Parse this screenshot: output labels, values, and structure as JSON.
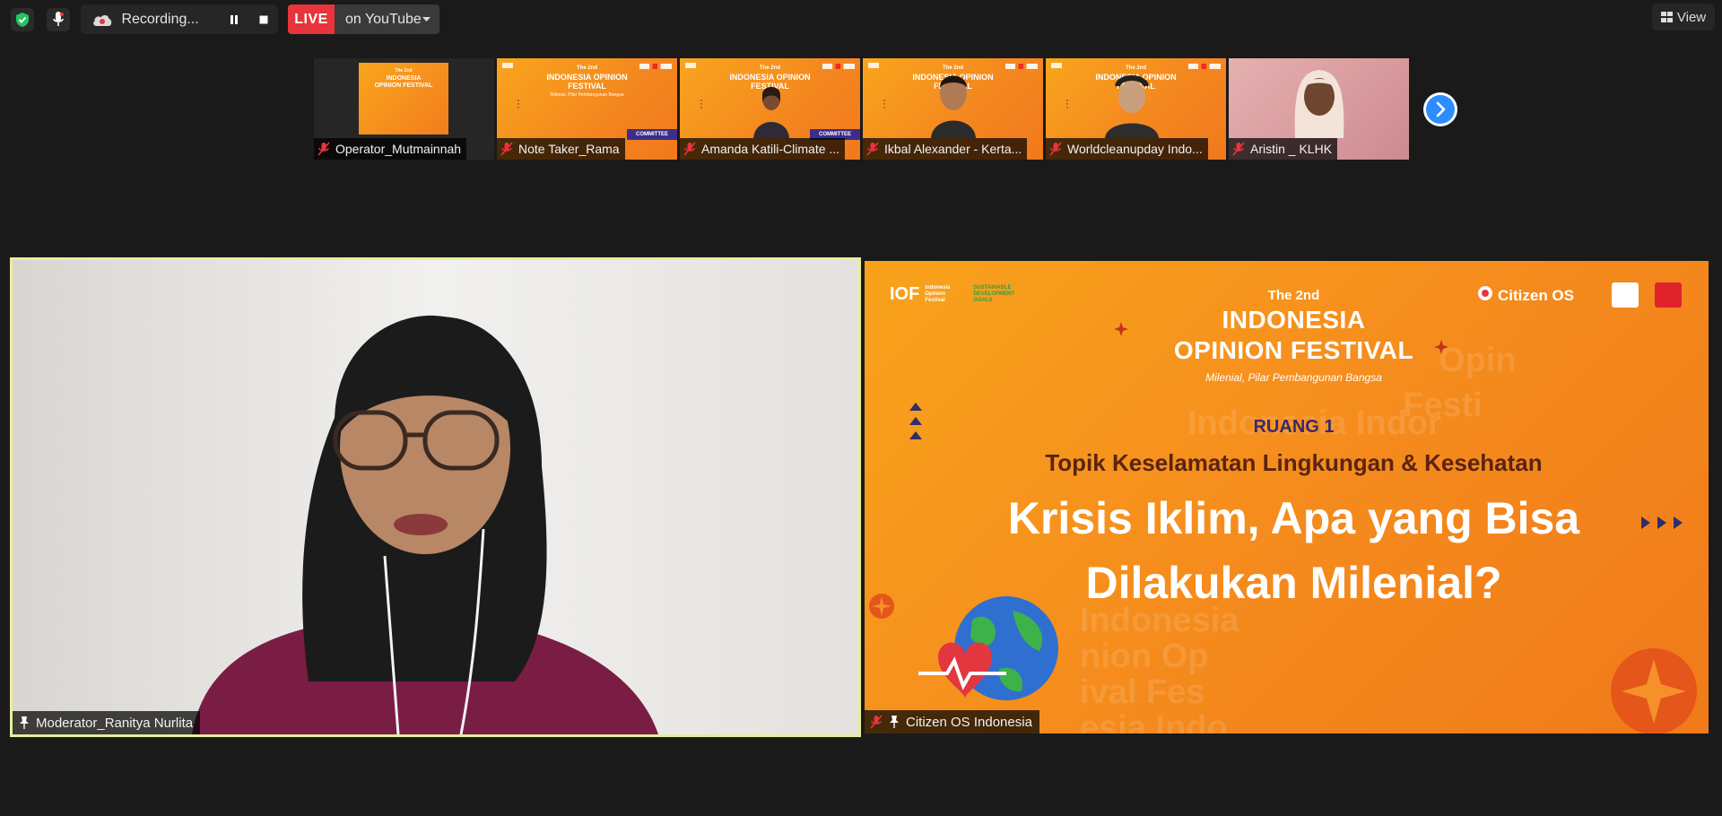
{
  "topbar": {
    "recording_label": "Recording...",
    "live_label": "LIVE",
    "live_target": "on YouTube",
    "view_label": "View"
  },
  "participants": [
    {
      "name": "Operator_Mutmainnah"
    },
    {
      "name": "Note Taker_Rama"
    },
    {
      "name": "Amanda Katili-Climate ..."
    },
    {
      "name": "Ikbal Alexander - Kerta..."
    },
    {
      "name": "Worldcleanupday Indo..."
    },
    {
      "name": "Aristin _ KLHK"
    }
  ],
  "thumb_slide": {
    "the2nd": "The 2nd",
    "title": "INDONESIA OPINION FESTIVAL",
    "tagline": "Milenial, Pilar Pembangunan Bangsa",
    "committee": "COMMITTEE"
  },
  "main": {
    "left_name": "Moderator_Ranitya Nurlita",
    "right_name": "Citizen OS Indonesia"
  },
  "slide": {
    "iof_logo": "IOF",
    "iof_text": "Indonesia Opinion Festival",
    "sdg_text": "SUSTAINABLE DEVELOPMENT GOALS",
    "citizen_os": "Citizen OS",
    "the2nd": "The 2nd",
    "title_line1": "INDONESIA",
    "title_line2": "OPINION FESTIVAL",
    "tagline": "Milenial, Pilar Pembangunan Bangsa",
    "ruang": "RUANG 1",
    "topik": "Topik Keselamatan Lingkungan & Kesehatan",
    "headline_line1": "Krisis Iklim, Apa yang Bisa",
    "headline_line2": "Dilakukan Milenial?"
  },
  "colors": {
    "live_red": "#e8343c",
    "zoom_blue": "#2d8cff",
    "active_speaker_border": "#e8ee9a",
    "slide_orange": "#f58c1d"
  }
}
